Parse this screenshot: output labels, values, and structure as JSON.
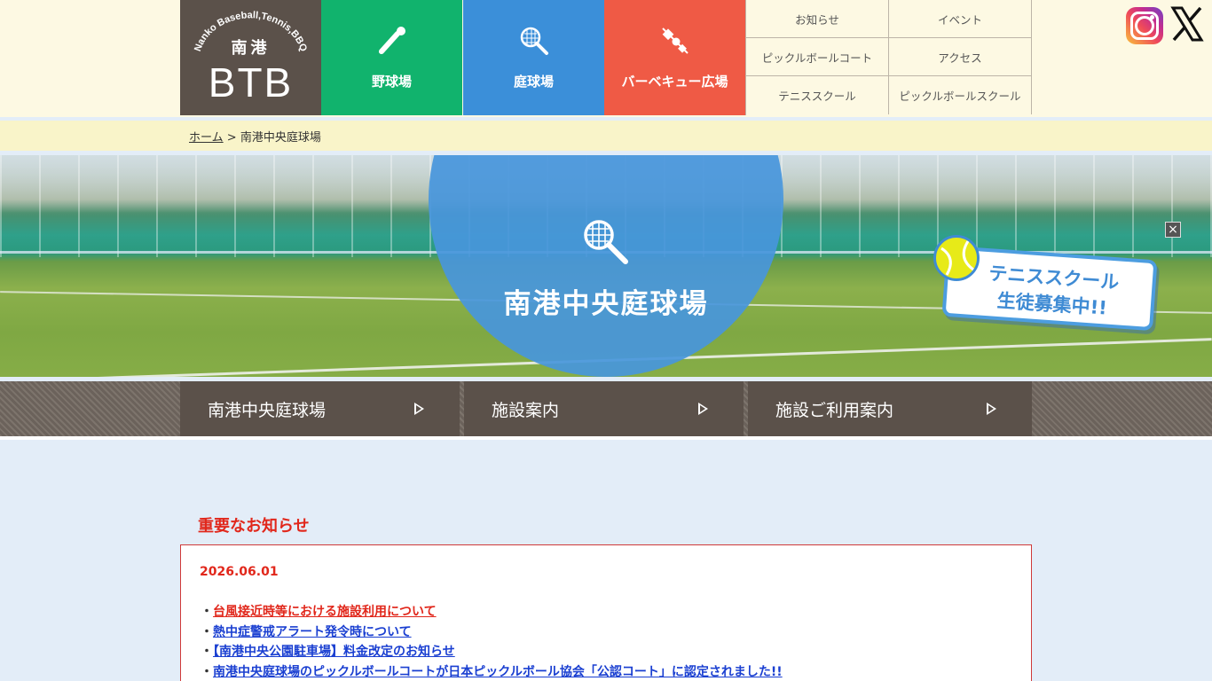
{
  "logo": {
    "arc_text": "Nanko Baseball,Tennis,BBQ",
    "jp": "南港",
    "en": "BTB"
  },
  "main_nav": [
    {
      "label": "野球場",
      "icon": "baseball-bat-icon",
      "color": "#11b36d"
    },
    {
      "label": "庭球場",
      "icon": "tennis-racket-icon",
      "color": "#3b8fd9"
    },
    {
      "label": "バーベキュー広場",
      "icon": "bbq-skewer-icon",
      "color": "#ef5a45"
    }
  ],
  "sub_nav": [
    {
      "label": "お知らせ"
    },
    {
      "label": "イベント"
    },
    {
      "label": "ピックルボールコート"
    },
    {
      "label": "アクセス"
    },
    {
      "label": "テニススクール"
    },
    {
      "label": "ピックルボールスクール"
    }
  ],
  "sns": {
    "instagram": "instagram-icon",
    "x": "x-icon"
  },
  "breadcrumb": {
    "home": "ホーム",
    "separator": ">",
    "current": "南港中央庭球場"
  },
  "hero": {
    "title": "南港中央庭球場",
    "promo_line1": "テニススクール",
    "promo_line2": "生徒募集中!!",
    "close": "×"
  },
  "tabs": [
    {
      "label": "南港中央庭球場"
    },
    {
      "label": "施設案内"
    },
    {
      "label": "施設ご利用案内"
    }
  ],
  "notice": {
    "heading": "重要なお知らせ",
    "date": "2026.06.01",
    "bullet": "・",
    "items": [
      {
        "text": "台風接近時等における施設利用について",
        "color": "#e1271b"
      },
      {
        "text": "熱中症警戒アラート発令時について",
        "color": "#1a3fd1"
      },
      {
        "text": "【南港中央公園駐車場】料金改定のお知らせ",
        "color": "#1a3fd1"
      },
      {
        "text": "南港中央庭球場のピックルボールコートが日本ピックルボール協会「公認コート」に認定されました!!",
        "color": "#1a3fd1"
      }
    ]
  }
}
